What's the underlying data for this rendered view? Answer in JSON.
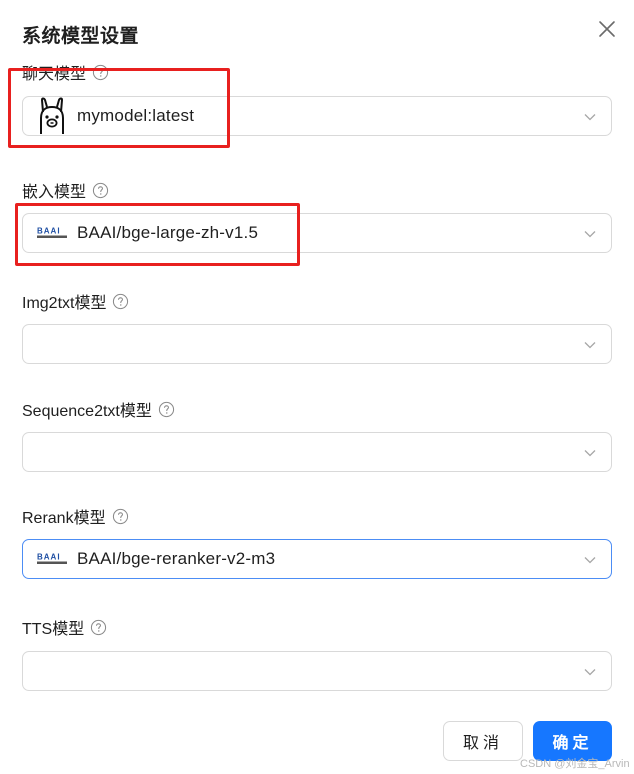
{
  "dialog": {
    "title": "系统模型设置",
    "close_icon": "close-icon"
  },
  "fields": {
    "chat": {
      "label": "聊天模型",
      "value": "mymodel:latest",
      "icon": "llama-icon"
    },
    "embedding": {
      "label": "嵌入模型",
      "value": "BAAI/bge-large-zh-v1.5",
      "icon": "baai-logo-icon"
    },
    "img2txt": {
      "label": "Img2txt模型",
      "value": ""
    },
    "sequence2txt": {
      "label": "Sequence2txt模型",
      "value": ""
    },
    "rerank": {
      "label": "Rerank模型",
      "value": "BAAI/bge-reranker-v2-m3",
      "icon": "baai-logo-icon"
    },
    "tts": {
      "label": "TTS模型",
      "value": ""
    }
  },
  "footer": {
    "cancel_label": "取消",
    "ok_label": "确定"
  },
  "watermark": "CSDN @刘金宝_Arvin",
  "colors": {
    "primary": "#1677ff",
    "highlight": "#e8201f",
    "border": "#d9d9d9",
    "focus_border": "#4c8df5"
  }
}
